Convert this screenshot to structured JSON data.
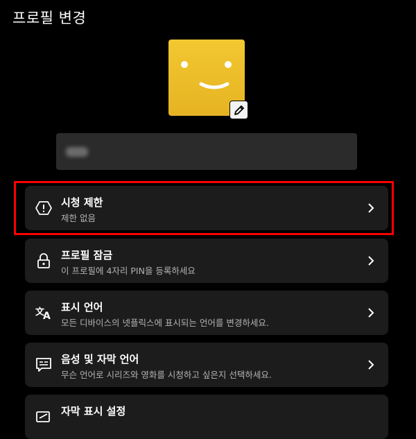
{
  "header": {
    "title": "프로필 변경"
  },
  "colors": {
    "accent": "#e6b322",
    "highlight": "#ff0000"
  },
  "profile": {
    "avatar": "smiley-avatar",
    "edit_icon": "pencil-icon"
  },
  "menu": [
    {
      "title": "시청 제한",
      "desc": "제한 없음",
      "icon": "shield-alert-icon"
    },
    {
      "title": "프로필 잠금",
      "desc": "이 프로필에 4자리 PIN을 등록하세요",
      "icon": "lock-icon"
    },
    {
      "title": "표시 언어",
      "desc": "모든 디바이스의 넷플릭스에 표시되는 언어를 변경하세요.",
      "icon": "translate-icon"
    },
    {
      "title": "음성 및 자막 언어",
      "desc": "무슨 언어로 시리즈와 영화를 시청하고 싶은지 선택하세요.",
      "icon": "subtitles-icon"
    },
    {
      "title": "자막 표시 설정",
      "icon": "caption-edit-icon"
    }
  ]
}
